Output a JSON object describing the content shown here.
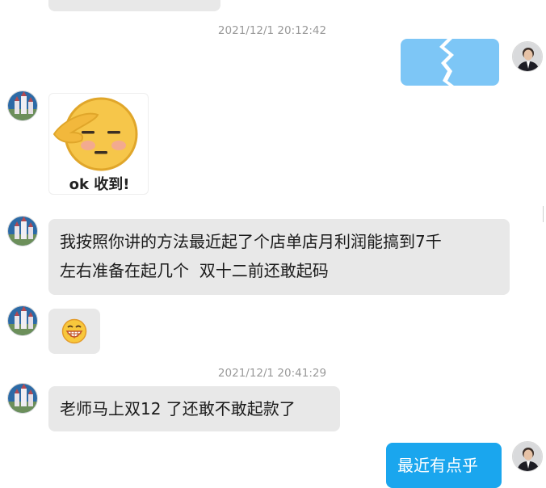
{
  "timestamps": [
    "2021/12/1 20:12:42",
    "2021/12/1 20:41:29"
  ],
  "sticker": {
    "caption": "ok 收到!"
  },
  "messages": {
    "line1": "我按照你讲的方法最近起了个店单店月利润能搞到7千",
    "line2": "左右准备在起几个  双十二前还敢起码",
    "question": "老师马上双12 了还敢不敢起款了",
    "reply_partial": "最近有点乎"
  },
  "emoji": {
    "grin": "😁"
  }
}
